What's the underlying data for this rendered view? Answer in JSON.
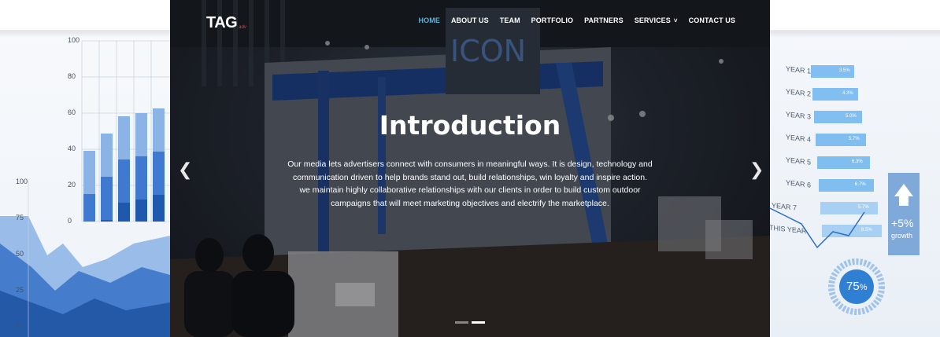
{
  "nav": {
    "logo_main": "TAG",
    "logo_sub": "adv",
    "items": [
      {
        "label": "HOME",
        "active": true
      },
      {
        "label": "ABOUT US",
        "active": false
      },
      {
        "label": "TEAM",
        "active": false
      },
      {
        "label": "PORTFOLIO",
        "active": false
      },
      {
        "label": "PARTNERS",
        "active": false
      },
      {
        "label": "SERVICES",
        "active": false,
        "has_dropdown": true
      },
      {
        "label": "CONTACT US",
        "active": false
      }
    ],
    "active_color": "#5fb4d9"
  },
  "hero": {
    "title": "Introduction",
    "description": "Our media lets advertisers connect with consumers in meaningful ways. It is design, technology and communication driven to help brands stand out, build relationships, win loyalty and inspire action. we maintain highly collaborative relationships with our clients in order to build custom outdoor campaigns that will meet marketing objectives and electrify the marketplace.",
    "booth_sign": "ICON",
    "slider": {
      "prev_icon": "chevron-left-icon",
      "next_icon": "chevron-right-icon",
      "slide_count": 2,
      "active_slide": 2
    }
  },
  "decor_left": {
    "bar_axis": [
      "100",
      "80",
      "60",
      "40",
      "20",
      "0"
    ],
    "area_axis": [
      "100",
      "75",
      "50",
      "25",
      "0"
    ]
  },
  "decor_right": {
    "years": [
      "YEAR 1",
      "YEAR 2",
      "YEAR 3",
      "YEAR 4",
      "YEAR 5",
      "YEAR 6",
      "YEAR 7",
      "THIS YEAR"
    ],
    "bar_labels": [
      "3.5%",
      "4.3%",
      "5.0%",
      "5.7%",
      "6.3%",
      "6.7%",
      "5.7%",
      "8.5%"
    ],
    "growth_value": "+5%",
    "growth_label": "growth",
    "donut_value": "75",
    "donut_unit": "%"
  }
}
